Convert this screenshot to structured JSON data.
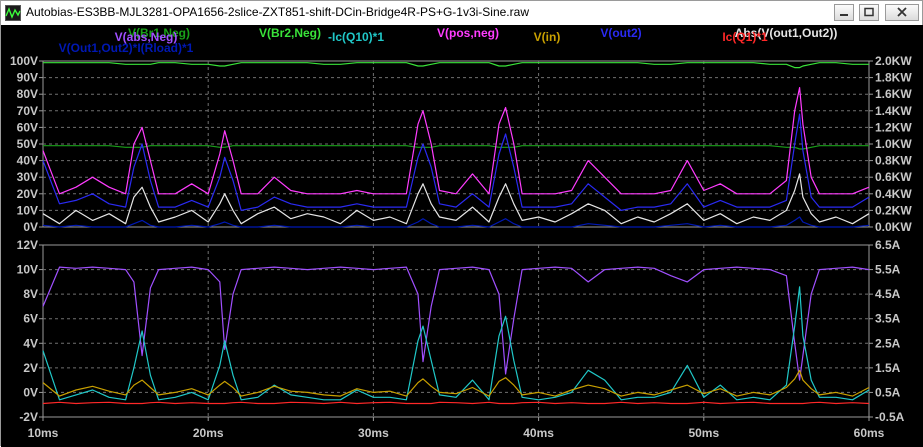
{
  "window": {
    "title": "Autobias-ES3BB-MJL3281-OPA1656-2slice-ZXT851-shift-DCin-Bridge4R-PS+G-1v3i-Sine.raw",
    "icons": {
      "app": "waveform-app-icon",
      "minimize": "minimize-icon",
      "maximize": "maximize-icon",
      "close": "close-icon"
    }
  },
  "colors": {
    "background": "#000000",
    "grid": "#707070",
    "axis_text": "#c8c8c8"
  },
  "chart_data": [
    {
      "type": "line",
      "pane": "top",
      "x": [
        10,
        11,
        12,
        13,
        14,
        15,
        15.5,
        16,
        16.5,
        17,
        18,
        19,
        20,
        20.7,
        21,
        21.5,
        22,
        23,
        24,
        25,
        26,
        27,
        28,
        29,
        30,
        31,
        32,
        32.7,
        33,
        33.5,
        34,
        35,
        36,
        37,
        37.6,
        38,
        38.5,
        39,
        40,
        41,
        42,
        43,
        44,
        45,
        46,
        47,
        48,
        49,
        50,
        51,
        52,
        53,
        54,
        55,
        55.5,
        55.8,
        56,
        56.5,
        57,
        58,
        59,
        60
      ],
      "xticks": [
        "10ms",
        "20ms",
        "30ms",
        "40ms",
        "50ms",
        "60ms"
      ],
      "xlim": [
        10,
        60
      ],
      "left_axis": {
        "ticks": [
          "0V",
          "10V",
          "20V",
          "30V",
          "40V",
          "50V",
          "60V",
          "70V",
          "80V",
          "90V",
          "100V"
        ],
        "ylim": [
          0,
          100
        ]
      },
      "right_axis": {
        "ticks": [
          "0.0KW",
          "0.2KW",
          "0.4KW",
          "0.6KW",
          "0.8KW",
          "1.0KW",
          "1.2KW",
          "1.4KW",
          "1.6KW",
          "1.8KW",
          "2.0KW"
        ],
        "ylim": [
          0,
          2000
        ]
      },
      "series": [
        {
          "name": "V(Br1,Neg)",
          "color": "#19a019",
          "axis": "left",
          "values": [
            49,
            49,
            49,
            49,
            49,
            48,
            48,
            48,
            49,
            49,
            49,
            49,
            49,
            48,
            48,
            49,
            49,
            49,
            49,
            49,
            49,
            49,
            49,
            49,
            49,
            49,
            49,
            48,
            48,
            48,
            49,
            49,
            49,
            49,
            48,
            48,
            48,
            49,
            49,
            49,
            49,
            49,
            49,
            49,
            49,
            49,
            49,
            49,
            49,
            49,
            49,
            49,
            49,
            48,
            48,
            47,
            47,
            48,
            49,
            49,
            49,
            49
          ]
        },
        {
          "name": "V(Br2,Neg)",
          "color": "#39e339",
          "axis": "left",
          "values": [
            99,
            99,
            99,
            99,
            99,
            98,
            98,
            98,
            98,
            99,
            99,
            98,
            98,
            97,
            97,
            98,
            99,
            99,
            99,
            99,
            99,
            98,
            98,
            99,
            99,
            99,
            99,
            97,
            97,
            98,
            99,
            99,
            99,
            99,
            97,
            97,
            98,
            99,
            99,
            99,
            99,
            99,
            99,
            99,
            99,
            98,
            98,
            99,
            99,
            99,
            99,
            99,
            98,
            98,
            96,
            96,
            97,
            98,
            99,
            99,
            98,
            98
          ]
        },
        {
          "name": "V(pos,neg)",
          "color": "#ff3cff",
          "axis": "left",
          "values": [
            46,
            20,
            24,
            30,
            24,
            20,
            50,
            60,
            40,
            20,
            20,
            26,
            20,
            44,
            58,
            40,
            20,
            20,
            30,
            22,
            20,
            20,
            20,
            22,
            20,
            20,
            20,
            62,
            70,
            50,
            22,
            20,
            32,
            20,
            62,
            72,
            50,
            20,
            20,
            20,
            22,
            40,
            30,
            20,
            20,
            20,
            22,
            40,
            22,
            26,
            20,
            20,
            20,
            28,
            70,
            84,
            62,
            30,
            20,
            20,
            20,
            24
          ]
        },
        {
          "name": "V(out2)",
          "color": "#2a2af2",
          "axis": "left",
          "values": [
            40,
            14,
            16,
            20,
            14,
            12,
            36,
            50,
            28,
            12,
            12,
            16,
            12,
            30,
            42,
            28,
            10,
            12,
            18,
            14,
            12,
            12,
            12,
            14,
            12,
            12,
            12,
            42,
            50,
            36,
            14,
            12,
            20,
            12,
            44,
            56,
            36,
            12,
            12,
            12,
            14,
            26,
            18,
            10,
            12,
            12,
            14,
            26,
            12,
            16,
            12,
            12,
            12,
            16,
            50,
            68,
            46,
            18,
            12,
            12,
            12,
            18
          ]
        },
        {
          "name": "Abs(V(out1,Out2))",
          "color": "#e6e6e6",
          "axis": "left",
          "values": [
            8,
            2,
            10,
            4,
            8,
            2,
            18,
            24,
            12,
            3,
            6,
            10,
            3,
            14,
            20,
            10,
            2,
            8,
            12,
            5,
            8,
            6,
            2,
            10,
            4,
            6,
            2,
            20,
            26,
            14,
            6,
            4,
            12,
            3,
            18,
            26,
            14,
            4,
            6,
            3,
            8,
            14,
            10,
            2,
            6,
            3,
            8,
            14,
            4,
            8,
            2,
            6,
            4,
            10,
            22,
            32,
            18,
            8,
            3,
            6,
            2,
            8
          ]
        },
        {
          "name": "V(Out1,Out2)*I(Rload)*1",
          "color": "#0018b4",
          "axis": "left",
          "values": [
            1,
            0,
            1,
            0,
            0,
            0,
            2,
            4,
            1,
            0,
            0,
            1,
            0,
            2,
            3,
            1,
            0,
            0,
            1,
            0,
            0,
            0,
            0,
            1,
            0,
            0,
            0,
            3,
            5,
            2,
            0,
            0,
            1,
            0,
            3,
            5,
            2,
            0,
            0,
            0,
            0,
            2,
            1,
            0,
            0,
            0,
            1,
            2,
            0,
            1,
            0,
            0,
            0,
            1,
            4,
            6,
            3,
            1,
            0,
            0,
            0,
            1
          ]
        }
      ]
    },
    {
      "type": "line",
      "pane": "bottom",
      "x": [
        10,
        11,
        12,
        13,
        14,
        15,
        15.5,
        16,
        16.5,
        17,
        18,
        19,
        20,
        20.7,
        21,
        21.5,
        22,
        23,
        24,
        25,
        26,
        27,
        28,
        29,
        30,
        31,
        32,
        32.7,
        33,
        33.5,
        34,
        35,
        36,
        37,
        37.6,
        38,
        38.5,
        39,
        40,
        41,
        42,
        43,
        44,
        45,
        46,
        47,
        48,
        49,
        50,
        51,
        52,
        53,
        54,
        55,
        55.5,
        55.8,
        56,
        56.5,
        57,
        58,
        59,
        60
      ],
      "xticks": [
        "10ms",
        "20ms",
        "30ms",
        "40ms",
        "50ms",
        "60ms"
      ],
      "xlim": [
        10,
        60
      ],
      "left_axis": {
        "ticks": [
          "-2V",
          "0V",
          "2V",
          "4V",
          "6V",
          "8V",
          "10V",
          "12V"
        ],
        "ylim": [
          -2,
          12
        ]
      },
      "right_axis": {
        "ticks": [
          "-0.5A",
          "0.5A",
          "1.5A",
          "2.5A",
          "3.5A",
          "4.5A",
          "5.5A",
          "6.5A"
        ],
        "ylim": [
          -0.5,
          6.5
        ]
      },
      "series": [
        {
          "name": "V(abs,Neg)",
          "color": "#a050ff",
          "axis": "left",
          "values": [
            7,
            10.2,
            10.1,
            10.2,
            10.1,
            10,
            9,
            3,
            8.5,
            10,
            10.1,
            10.2,
            10,
            9,
            3.5,
            8,
            10,
            10.1,
            10.2,
            10.1,
            10,
            10.1,
            10.2,
            10.1,
            10,
            10.1,
            10.2,
            8,
            2.5,
            7,
            10,
            10.1,
            10.2,
            10,
            8,
            1.5,
            6,
            10,
            10.1,
            10.2,
            10.1,
            9,
            10,
            10.1,
            10.2,
            10.1,
            9.5,
            9,
            10,
            10.1,
            10.2,
            10.1,
            10,
            9.5,
            4,
            1,
            3,
            8,
            10,
            10.1,
            10.2,
            10
          ]
        },
        {
          "name": "-Ic(Q10)*1",
          "color": "#20c8c8",
          "axis": "right",
          "values": [
            2.2,
            0.2,
            0.4,
            0.6,
            0.3,
            0.2,
            1.5,
            3,
            1.2,
            0.2,
            0.3,
            0.5,
            0.2,
            1.6,
            2.6,
            1.2,
            0.2,
            0.3,
            0.8,
            0.4,
            0.3,
            0.2,
            0.2,
            0.6,
            0.3,
            0.3,
            0.2,
            2.6,
            3.2,
            1.8,
            0.4,
            0.3,
            1,
            0.2,
            2.8,
            3.6,
            1.8,
            0.3,
            0.2,
            0.3,
            0.5,
            1.4,
            1,
            0.2,
            0.3,
            0.3,
            0.5,
            1.6,
            0.3,
            0.8,
            0.2,
            0.3,
            0.2,
            0.8,
            3.2,
            4.8,
            2.8,
            1,
            0.3,
            0.3,
            0.2,
            0.6
          ]
        },
        {
          "name": "V(in)",
          "color": "#c8a000",
          "axis": "left",
          "values": [
            0.8,
            -0.3,
            0.2,
            0.5,
            0.1,
            -0.2,
            0.6,
            1,
            0.4,
            -0.2,
            0,
            0.3,
            -0.2,
            0.6,
            0.9,
            0.4,
            -0.3,
            0,
            0.5,
            0.1,
            0,
            -0.2,
            -0.3,
            0.3,
            0,
            0.1,
            -0.3,
            0.8,
            1.1,
            0.5,
            0,
            -0.1,
            0.4,
            -0.3,
            0.9,
            1.2,
            0.6,
            -0.2,
            0,
            -0.3,
            0.2,
            0.6,
            0.3,
            -0.3,
            0,
            -0.2,
            0.2,
            0.6,
            -0.1,
            0.3,
            -0.3,
            0,
            -0.2,
            0.4,
            1.1,
            1.8,
            1,
            0.3,
            -0.2,
            0,
            -0.3,
            0.4
          ]
        },
        {
          "name": "Ic(Q1)*1",
          "color": "#ff2828",
          "axis": "right",
          "values": [
            0.05,
            0.1,
            0.05,
            0.08,
            0.1,
            0.05,
            0.05,
            0.05,
            0.08,
            0.1,
            0.05,
            0.08,
            0.05,
            0.05,
            0.05,
            0.08,
            0.1,
            0.05,
            0.05,
            0.1,
            0.08,
            0.05,
            0.1,
            0.05,
            0.08,
            0.1,
            0.05,
            0.05,
            0.05,
            0.05,
            0.1,
            0.08,
            0.05,
            0.1,
            0.05,
            0.05,
            0.05,
            0.08,
            0.1,
            0.05,
            0.08,
            0.05,
            0.05,
            0.1,
            0.05,
            0.08,
            0.05,
            0.05,
            0.1,
            0.05,
            0.08,
            0.1,
            0.05,
            0.05,
            0.05,
            0.05,
            0.05,
            0.08,
            0.1,
            0.05,
            0.08,
            0.05
          ]
        }
      ]
    }
  ]
}
